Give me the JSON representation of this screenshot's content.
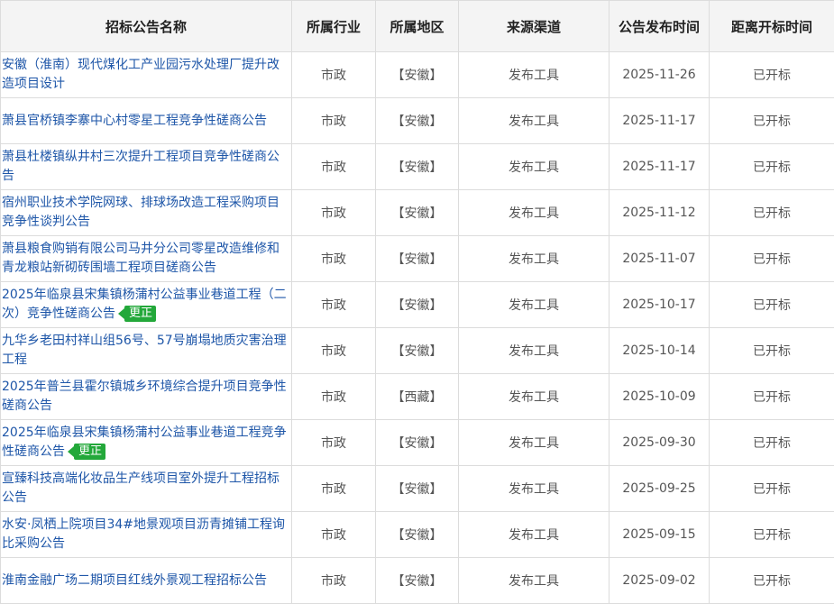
{
  "table": {
    "headers": {
      "name": "招标公告名称",
      "industry": "所属行业",
      "region": "所属地区",
      "source": "来源渠道",
      "publish_date": "公告发布时间",
      "time_to_open": "距离开标时间"
    },
    "rows": [
      {
        "name": "安徽（淮南）现代煤化工产业园污水处理厂提升改造项目设计",
        "industry": "市政",
        "region": "【安徽】",
        "source": "发布工具",
        "date": "2025-11-26",
        "status": "已开标",
        "tag": ""
      },
      {
        "name": "萧县官桥镇李寨中心村零星工程竞争性磋商公告",
        "industry": "市政",
        "region": "【安徽】",
        "source": "发布工具",
        "date": "2025-11-17",
        "status": "已开标",
        "tag": ""
      },
      {
        "name": "萧县杜楼镇纵井村三次提升工程项目竞争性磋商公告",
        "industry": "市政",
        "region": "【安徽】",
        "source": "发布工具",
        "date": "2025-11-17",
        "status": "已开标",
        "tag": ""
      },
      {
        "name": "宿州职业技术学院网球、排球场改造工程采购项目竞争性谈判公告",
        "industry": "市政",
        "region": "【安徽】",
        "source": "发布工具",
        "date": "2025-11-12",
        "status": "已开标",
        "tag": ""
      },
      {
        "name": "萧县粮食购销有限公司马井分公司零星改造维修和青龙粮站新砌砖围墙工程项目磋商公告",
        "industry": "市政",
        "region": "【安徽】",
        "source": "发布工具",
        "date": "2025-11-07",
        "status": "已开标",
        "tag": ""
      },
      {
        "name": "2025年临泉县宋集镇杨蒲村公益事业巷道工程（二次）竞争性磋商公告",
        "industry": "市政",
        "region": "【安徽】",
        "source": "发布工具",
        "date": "2025-10-17",
        "status": "已开标",
        "tag": "更正"
      },
      {
        "name": "九华乡老田村祥山组56号、57号崩塌地质灾害治理工程",
        "industry": "市政",
        "region": "【安徽】",
        "source": "发布工具",
        "date": "2025-10-14",
        "status": "已开标",
        "tag": ""
      },
      {
        "name": "2025年普兰县霍尔镇城乡环境综合提升项目竞争性磋商公告",
        "industry": "市政",
        "region": "【西藏】",
        "source": "发布工具",
        "date": "2025-10-09",
        "status": "已开标",
        "tag": ""
      },
      {
        "name": "2025年临泉县宋集镇杨蒲村公益事业巷道工程竞争性磋商公告",
        "industry": "市政",
        "region": "【安徽】",
        "source": "发布工具",
        "date": "2025-09-30",
        "status": "已开标",
        "tag": "更正"
      },
      {
        "name": "宣臻科技高端化妆品生产线项目室外提升工程招标公告",
        "industry": "市政",
        "region": "【安徽】",
        "source": "发布工具",
        "date": "2025-09-25",
        "status": "已开标",
        "tag": ""
      },
      {
        "name": "水安·凤栖上院项目34#地景观项目沥青摊铺工程询比采购公告",
        "industry": "市政",
        "region": "【安徽】",
        "source": "发布工具",
        "date": "2025-09-15",
        "status": "已开标",
        "tag": ""
      },
      {
        "name": "淮南金融广场二期项目红线外景观工程招标公告",
        "industry": "市政",
        "region": "【安徽】",
        "source": "发布工具",
        "date": "2025-09-02",
        "status": "已开标",
        "tag": ""
      }
    ]
  },
  "colors": {
    "link": "#1e56a8",
    "header_bg": "#f4f4f4",
    "border": "#dcdcdc",
    "tag_bg": "#23a83a"
  }
}
